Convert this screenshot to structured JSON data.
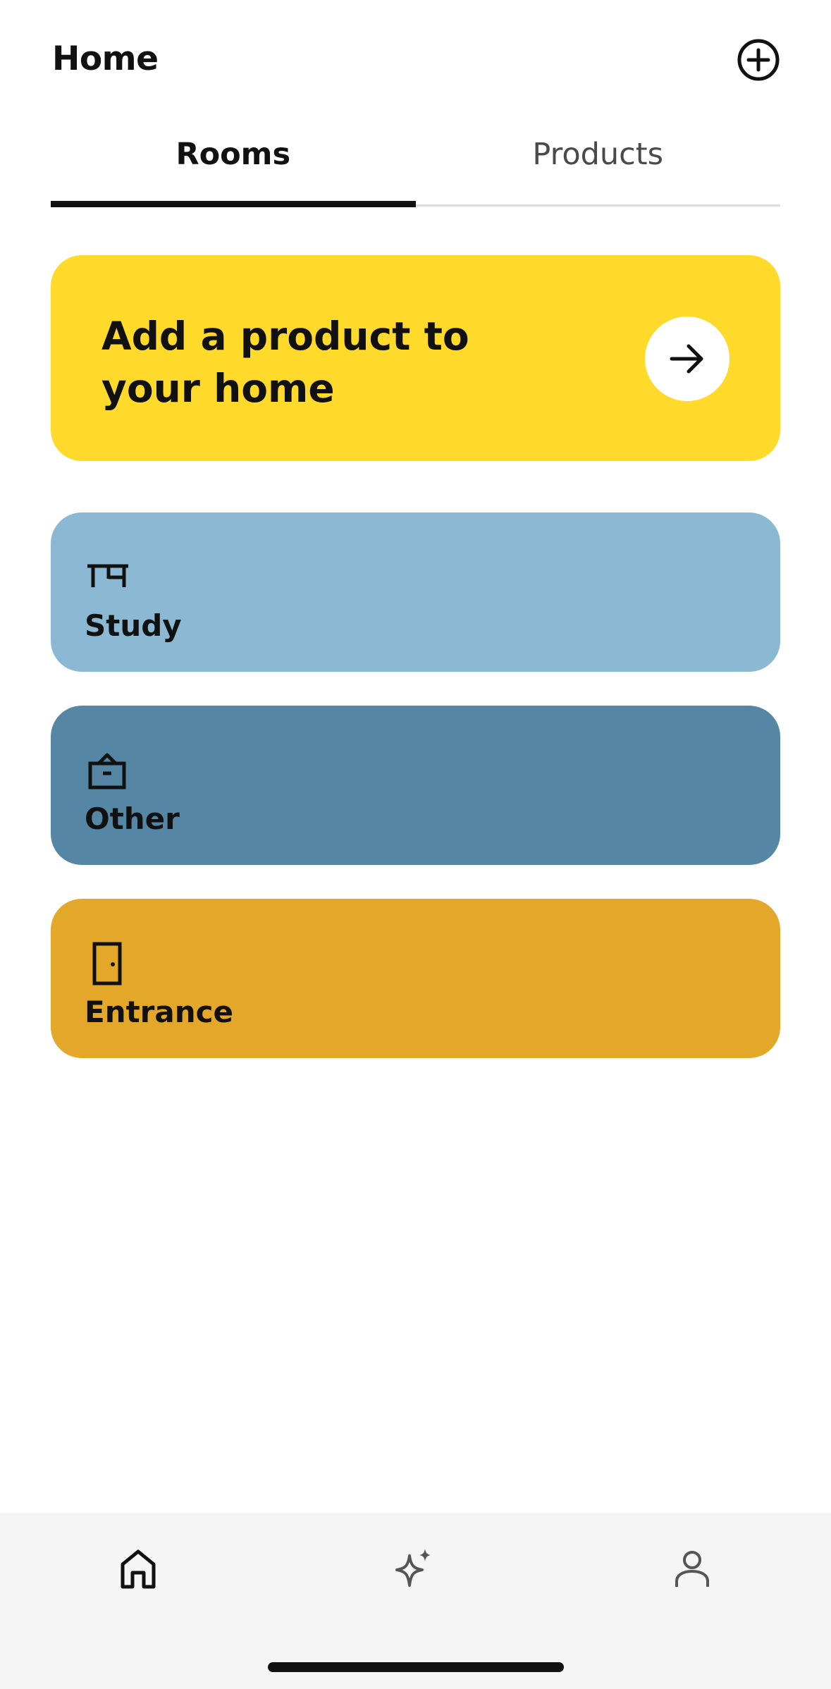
{
  "header": {
    "title": "Home",
    "add_icon": "plus-circle-icon"
  },
  "tabs": [
    {
      "label": "Rooms",
      "active": true
    },
    {
      "label": "Products",
      "active": false
    }
  ],
  "promo": {
    "text": "Add a product to your home",
    "color": "#FFDA2B",
    "icon": "arrow-right-icon"
  },
  "rooms": [
    {
      "label": "Study",
      "icon": "desk-icon",
      "color": "#8BB9D3"
    },
    {
      "label": "Other",
      "icon": "box-icon",
      "color": "#5587A5"
    },
    {
      "label": "Entrance",
      "icon": "door-icon",
      "color": "#E3A82A"
    }
  ],
  "bottom_nav": [
    {
      "icon": "home-icon",
      "active": true
    },
    {
      "icon": "sparkle-icon",
      "active": false
    },
    {
      "icon": "person-icon",
      "active": false
    }
  ]
}
